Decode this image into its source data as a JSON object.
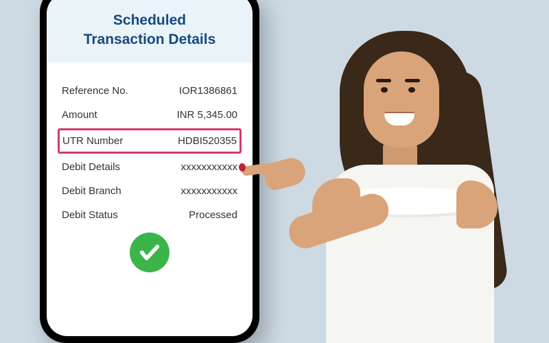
{
  "header": {
    "title_line1": "Scheduled",
    "title_line2": "Transaction Details"
  },
  "details": [
    {
      "label": "Reference No.",
      "value": "IOR1386861",
      "highlighted": false
    },
    {
      "label": "Amount",
      "value": "INR 5,345.00",
      "highlighted": false
    },
    {
      "label": "UTR Number",
      "value": "HDBI520355",
      "highlighted": true
    },
    {
      "label": "Debit Details",
      "value": "xxxxxxxxxxx",
      "highlighted": false
    },
    {
      "label": "Debit Branch",
      "value": "xxxxxxxxxxx",
      "highlighted": false
    },
    {
      "label": "Debit Status",
      "value": "Processed",
      "highlighted": false
    }
  ],
  "status_icon": "checkmark-success"
}
